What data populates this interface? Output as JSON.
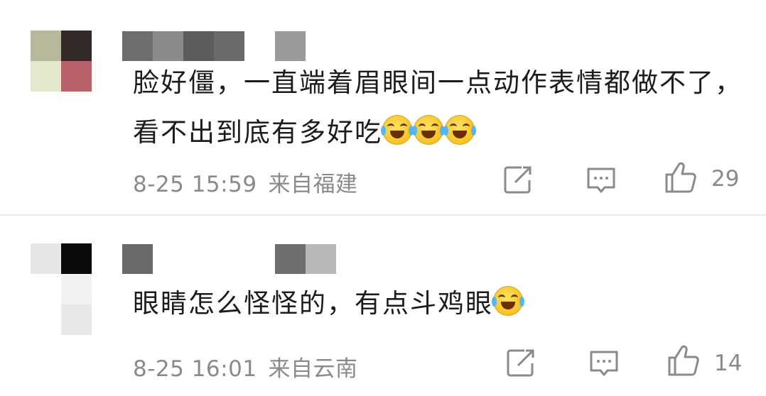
{
  "comments": [
    {
      "text": "脸好僵，一直端着眉眼间一点动作表情都做不了，看不出到底有多好吃",
      "emoji_count": 3,
      "time": "8-25 15:59",
      "location": "来自福建",
      "likes": "29"
    },
    {
      "text": "眼睛怎么怪怪的，有点斗鸡眼",
      "emoji_count": 1,
      "time": "8-25 16:01",
      "location": "来自云南",
      "likes": "14"
    }
  ],
  "icons": {
    "emoji": "laughing-crying-emoji-icon",
    "share": "share-icon",
    "reply": "comment-icon",
    "like": "thumbs-up-icon"
  },
  "colors": {
    "text": "#1c1c1c",
    "meta": "#8a8a8a",
    "divider": "#ebebeb"
  }
}
